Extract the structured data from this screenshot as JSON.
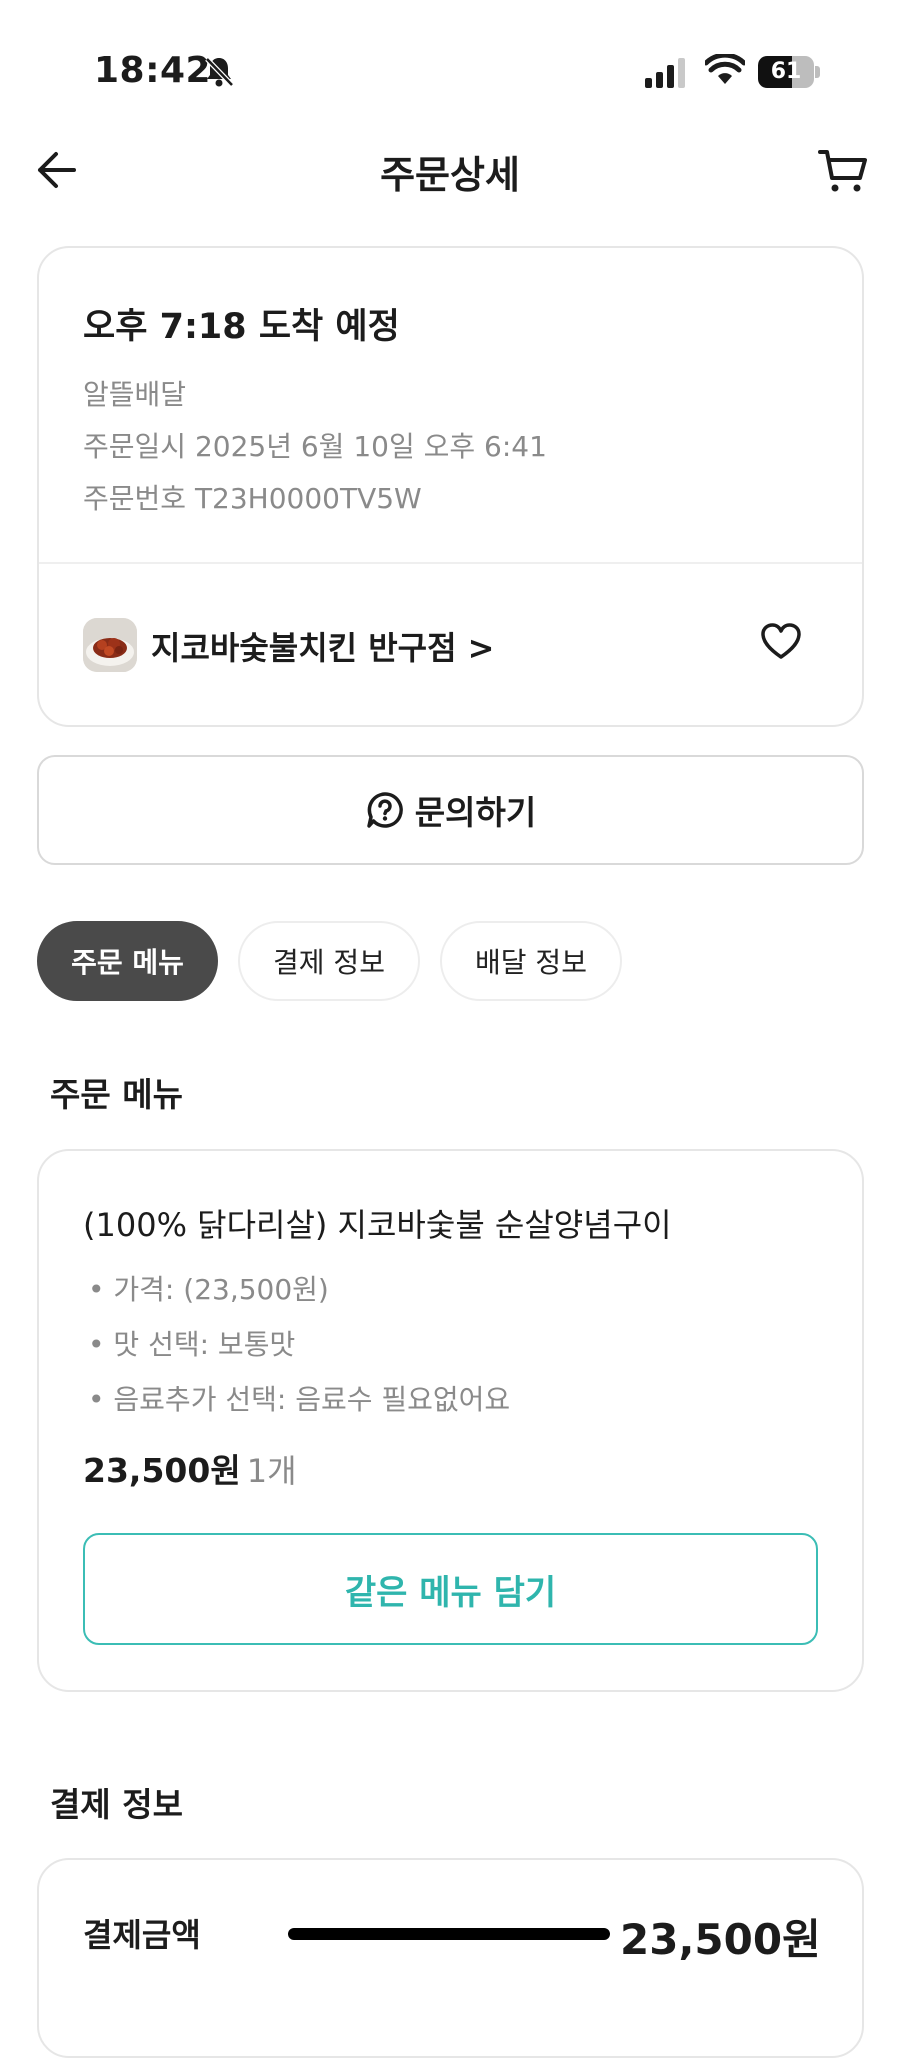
{
  "status_bar": {
    "time": "18:42",
    "battery": "61",
    "battery_level": 0.61
  },
  "header": {
    "title": "주문상세"
  },
  "order_card": {
    "eta": "오후 7:18 도착 예정",
    "delivery_type": "알뜰배달",
    "order_date": "주문일시 2025년 6월 10일 오후 6:41",
    "order_number": "주문번호 T23H0000TV5W",
    "store_name": "지코바숯불치킨 반구점 >"
  },
  "inquiry_button": {
    "label": "문의하기"
  },
  "tabs": [
    {
      "label": "주문 메뉴",
      "active": true
    },
    {
      "label": "결제 정보",
      "active": false
    },
    {
      "label": "배달 정보",
      "active": false
    }
  ],
  "order_menu": {
    "section_title": "주문 메뉴",
    "item": {
      "name": "(100% 닭다리살) 지코바숯불 순살양념구이",
      "options": [
        "• 가격: (23,500원)",
        "• 맛 선택: 보통맛",
        "• 음료추가 선택: 음료수 필요없어요"
      ],
      "price": "23,500원",
      "quantity": "1개"
    },
    "same_menu_button": "같은 메뉴 담기"
  },
  "payment": {
    "section_title": "결제 정보",
    "label": "결제금액",
    "amount": "23,500원"
  },
  "colors": {
    "accent": "#2fb5ad",
    "active_tab": "#4a4a4a",
    "muted_text": "#8a8a8a"
  }
}
